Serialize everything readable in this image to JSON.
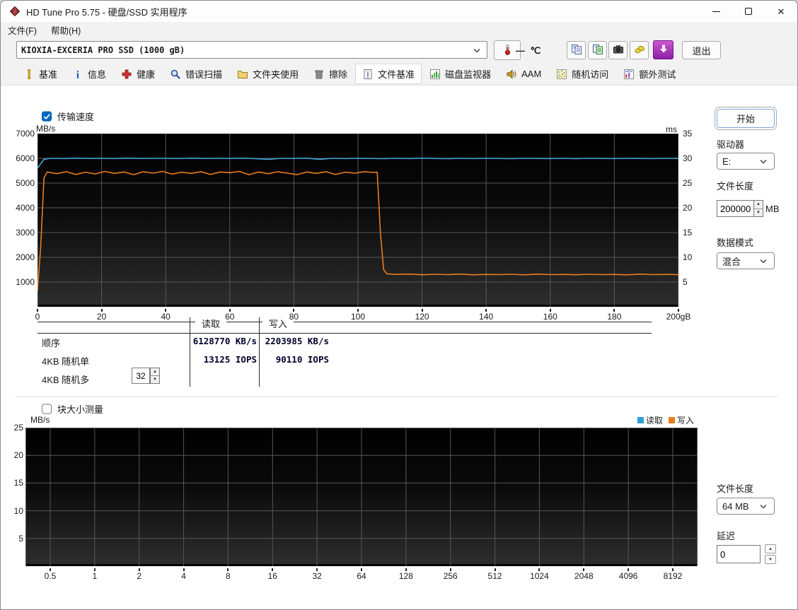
{
  "window": {
    "title": "HD Tune Pro 5.75 - 硬盘/SSD 实用程序",
    "controls": [
      {
        "name": "minimize"
      },
      {
        "name": "maximize"
      },
      {
        "name": "close"
      }
    ]
  },
  "menu": {
    "items": [
      {
        "label": "文件(F)"
      },
      {
        "label": "帮助(H)"
      }
    ]
  },
  "toolbar": {
    "drive": "KIOXIA-EXCERIA PRO SSD (1000 gB)",
    "temperature": "— ℃",
    "buttons": [
      {
        "name": "copy-to-clipboard",
        "icon": "copy-icon"
      },
      {
        "name": "copy-to-file",
        "icon": "copy-image-icon"
      },
      {
        "name": "screenshot",
        "icon": "camera-icon"
      },
      {
        "name": "options",
        "icon": "options-icon"
      },
      {
        "name": "update",
        "icon": "update-icon"
      }
    ],
    "exit_label": "退出"
  },
  "tabs": [
    {
      "key": "benchmark",
      "label": "基准",
      "icon": "exclamation-icon",
      "active": false
    },
    {
      "key": "info",
      "label": "信息",
      "icon": "info-icon",
      "active": false
    },
    {
      "key": "health",
      "label": "健康",
      "icon": "health-icon",
      "active": false
    },
    {
      "key": "error-scan",
      "label": "错误扫描",
      "icon": "magnifier-icon",
      "active": false
    },
    {
      "key": "folder-usage",
      "label": "文件夹使用",
      "icon": "folder-icon",
      "active": false
    },
    {
      "key": "erase",
      "label": "擦除",
      "icon": "trash-icon",
      "active": false
    },
    {
      "key": "file-benchmark",
      "label": "文件基准",
      "icon": "file-benchmark-icon",
      "active": true
    },
    {
      "key": "disk-monitor",
      "label": "磁盘监视器",
      "icon": "disk-monitor-icon",
      "active": false
    },
    {
      "key": "aam",
      "label": "AAM",
      "icon": "speaker-icon",
      "active": false
    },
    {
      "key": "random-access",
      "label": "随机访问",
      "icon": "random-access-icon",
      "active": false
    },
    {
      "key": "extra-tests",
      "label": "额外测试",
      "icon": "extra-tests-icon",
      "active": false
    }
  ],
  "benchmark": {
    "transfer_speed_label": "传输速度",
    "transfer_speed_checked": true,
    "table": {
      "read_header": "读取",
      "write_header": "写入",
      "rows": [
        {
          "label": "顺序",
          "read": "6128770 KB/s",
          "write": "2203985 KB/s"
        },
        {
          "label": "4KB 随机单",
          "read": "13125 IOPS",
          "write": "90110 IOPS"
        },
        {
          "label": "4KB 随机多",
          "read": "",
          "write": ""
        }
      ],
      "queue_depth": "32"
    }
  },
  "controls": {
    "start_label": "开始",
    "drive_label": "驱动器",
    "drive_value": "E:",
    "file_length_label": "文件长度",
    "file_length_value": "200000",
    "file_length_unit": "MB",
    "data_mode_label": "数据模式",
    "data_mode_value": "混合"
  },
  "block_test": {
    "label": "块大小测量",
    "checked": false,
    "file_length_label": "文件长度",
    "file_length_value": "64 MB",
    "delay_label": "延迟",
    "delay_value": "0"
  },
  "chart_data": [
    {
      "id": "transfer-speed-chart",
      "type": "line",
      "title": "传输速度",
      "ylabel_left": "MB/s",
      "ylabel_right": "ms",
      "xlim": [
        0,
        200
      ],
      "ylim_left": [
        0,
        7000
      ],
      "ylim_right": [
        0,
        35
      ],
      "grid": true,
      "x_ticks": [
        0,
        20,
        40,
        60,
        80,
        100,
        120,
        140,
        160,
        180,
        200
      ],
      "x_tick_labels": [
        "0",
        "20",
        "40",
        "60",
        "80",
        "100",
        "120",
        "140",
        "160",
        "180",
        "200gB"
      ],
      "y_ticks_left": [
        1000,
        2000,
        3000,
        4000,
        5000,
        6000,
        7000
      ],
      "y_ticks_right": [
        5,
        10,
        15,
        20,
        25,
        30,
        35
      ],
      "series": [
        {
          "name": "写入",
          "color": "#e87d1e",
          "points": [
            [
              0,
              650
            ],
            [
              1,
              2400
            ],
            [
              2,
              5200
            ],
            [
              3,
              5450
            ],
            [
              6,
              5380
            ],
            [
              9,
              5460
            ],
            [
              12,
              5350
            ],
            [
              15,
              5440
            ],
            [
              18,
              5370
            ],
            [
              21,
              5470
            ],
            [
              24,
              5390
            ],
            [
              27,
              5450
            ],
            [
              30,
              5340
            ],
            [
              33,
              5460
            ],
            [
              36,
              5400
            ],
            [
              39,
              5470
            ],
            [
              42,
              5360
            ],
            [
              45,
              5440
            ],
            [
              48,
              5390
            ],
            [
              51,
              5460
            ],
            [
              54,
              5350
            ],
            [
              57,
              5450
            ],
            [
              60,
              5420
            ],
            [
              63,
              5470
            ],
            [
              66,
              5340
            ],
            [
              69,
              5450
            ],
            [
              72,
              5380
            ],
            [
              75,
              5460
            ],
            [
              78,
              5400
            ],
            [
              81,
              5340
            ],
            [
              84,
              5450
            ],
            [
              87,
              5390
            ],
            [
              90,
              5460
            ],
            [
              93,
              5350
            ],
            [
              96,
              5440
            ],
            [
              99,
              5400
            ],
            [
              102,
              5460
            ],
            [
              105,
              5430
            ],
            [
              106,
              5440
            ],
            [
              107,
              3000
            ],
            [
              108,
              1500
            ],
            [
              109,
              1330
            ],
            [
              112,
              1310
            ],
            [
              116,
              1320
            ],
            [
              120,
              1295
            ],
            [
              124,
              1315
            ],
            [
              128,
              1300
            ],
            [
              132,
              1320
            ],
            [
              136,
              1290
            ],
            [
              140,
              1310
            ],
            [
              144,
              1300
            ],
            [
              148,
              1315
            ],
            [
              152,
              1290
            ],
            [
              156,
              1320
            ],
            [
              160,
              1300
            ],
            [
              164,
              1310
            ],
            [
              168,
              1295
            ],
            [
              172,
              1315
            ],
            [
              176,
              1300
            ],
            [
              180,
              1310
            ],
            [
              184,
              1290
            ],
            [
              188,
              1320
            ],
            [
              192,
              1300
            ],
            [
              196,
              1310
            ],
            [
              200,
              1300
            ]
          ]
        },
        {
          "name": "读取",
          "color": "#3fa3dc",
          "points": [
            [
              0,
              5600
            ],
            [
              2,
              5960
            ],
            [
              4,
              6000
            ],
            [
              8,
              5990
            ],
            [
              12,
              6005
            ],
            [
              16,
              5995
            ],
            [
              20,
              6000
            ],
            [
              24,
              5990
            ],
            [
              28,
              6005
            ],
            [
              32,
              5995
            ],
            [
              36,
              6000
            ],
            [
              40,
              6000
            ],
            [
              44,
              5990
            ],
            [
              48,
              6005
            ],
            [
              52,
              5995
            ],
            [
              56,
              6000
            ],
            [
              60,
              5995
            ],
            [
              64,
              6005
            ],
            [
              68,
              5985
            ],
            [
              72,
              5960
            ],
            [
              76,
              6000
            ],
            [
              80,
              5995
            ],
            [
              84,
              6005
            ],
            [
              88,
              5960
            ],
            [
              92,
              6000
            ],
            [
              96,
              5990
            ],
            [
              100,
              6000
            ],
            [
              104,
              5995
            ],
            [
              108,
              5985
            ],
            [
              112,
              6000
            ],
            [
              116,
              5990
            ],
            [
              120,
              6005
            ],
            [
              124,
              5995
            ],
            [
              128,
              5985
            ],
            [
              132,
              6000
            ],
            [
              136,
              5990
            ],
            [
              140,
              6000
            ],
            [
              144,
              5995
            ],
            [
              148,
              5985
            ],
            [
              152,
              6000
            ],
            [
              156,
              5995
            ],
            [
              160,
              5990
            ],
            [
              164,
              6000
            ],
            [
              168,
              5985
            ],
            [
              172,
              6000
            ],
            [
              176,
              5995
            ],
            [
              180,
              5990
            ],
            [
              184,
              6000
            ],
            [
              188,
              5995
            ],
            [
              192,
              5990
            ],
            [
              196,
              6000
            ],
            [
              200,
              5995
            ]
          ]
        }
      ]
    },
    {
      "id": "block-size-chart",
      "type": "line",
      "title": "块大小测量",
      "ylabel": "MB/s",
      "ylim": [
        0,
        25
      ],
      "grid": true,
      "y_ticks": [
        5,
        10,
        15,
        20,
        25
      ],
      "x_tick_labels": [
        "0.5",
        "1",
        "2",
        "4",
        "8",
        "16",
        "32",
        "64",
        "128",
        "256",
        "512",
        "1024",
        "2048",
        "4096",
        "8192"
      ],
      "legend": [
        {
          "label": "读取",
          "color": "#2f9fd8"
        },
        {
          "label": "写入",
          "color": "#e87d1e"
        }
      ],
      "series": []
    }
  ]
}
